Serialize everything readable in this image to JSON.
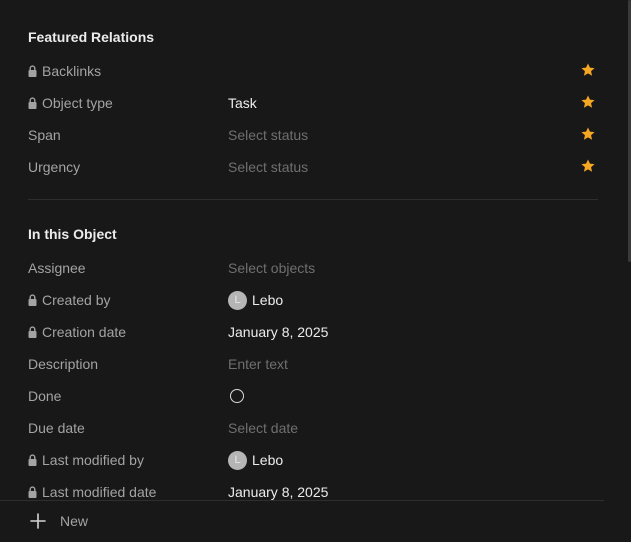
{
  "featured": {
    "title": "Featured Relations",
    "rows": [
      {
        "label": "Backlinks",
        "value": ""
      },
      {
        "label": "Object type",
        "value": "Task"
      },
      {
        "label": "Span",
        "value": "Select status"
      },
      {
        "label": "Urgency",
        "value": "Select status"
      }
    ]
  },
  "object": {
    "title": "In this Object",
    "rows": [
      {
        "label": "Assignee",
        "value": "Select objects"
      },
      {
        "label": "Created by",
        "value": "Lebo",
        "avatar": "L"
      },
      {
        "label": "Creation date",
        "value": "January 8, 2025"
      },
      {
        "label": "Description",
        "value": "Enter text"
      },
      {
        "label": "Done",
        "value": ""
      },
      {
        "label": "Due date",
        "value": "Select date"
      },
      {
        "label": "Last modified by",
        "value": "Lebo",
        "avatar": "L"
      },
      {
        "label": "Last modified date",
        "value": "January 8, 2025"
      }
    ]
  },
  "footer": {
    "new_label": "New"
  },
  "icons": {
    "lock": "lock-icon",
    "star": "star-icon",
    "plus": "plus-icon"
  },
  "colors": {
    "background": "#181818",
    "star": "#f5a623",
    "label": "#a3a3a3",
    "value": "#ececec",
    "placeholder": "#6f6f6f"
  }
}
